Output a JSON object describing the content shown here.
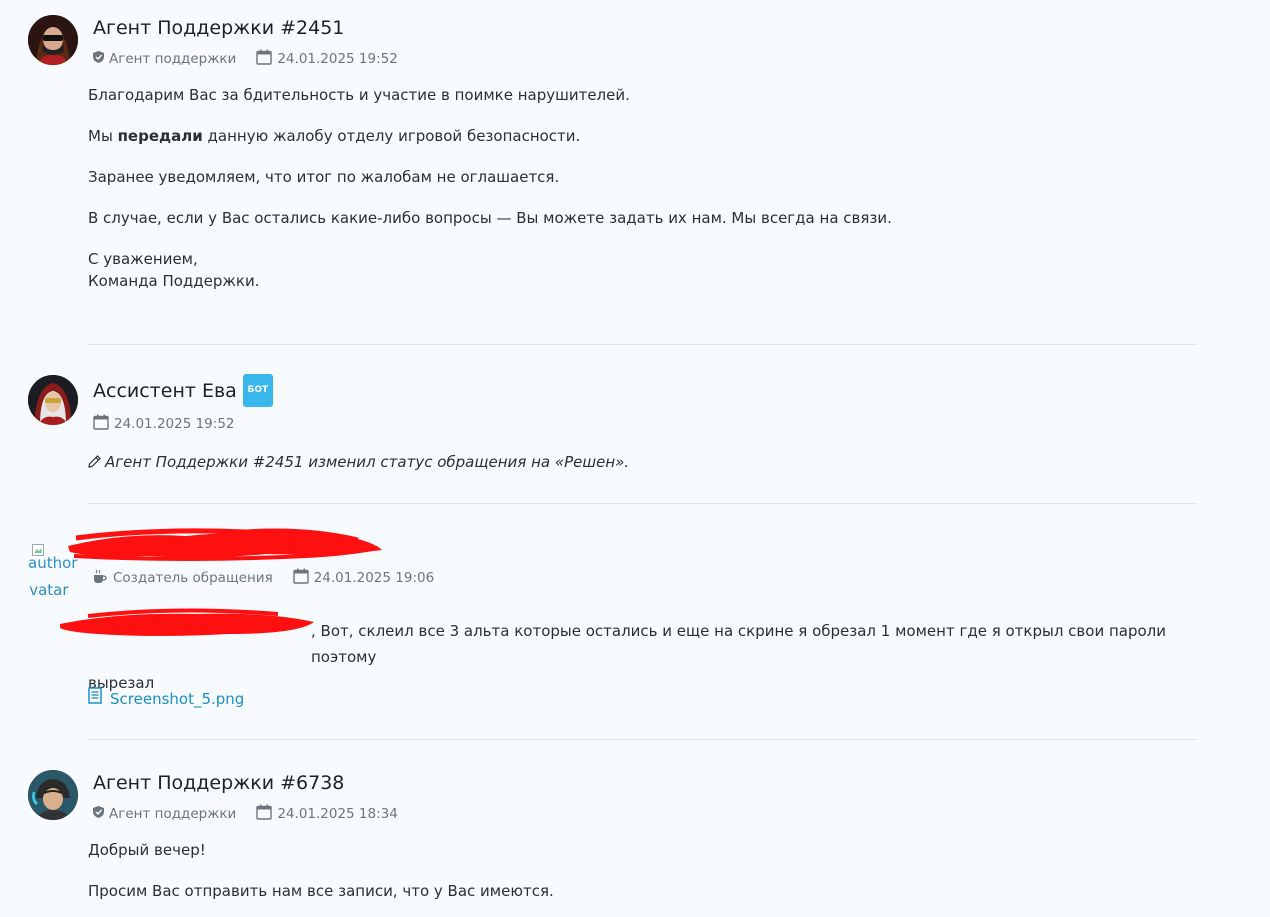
{
  "messages": [
    {
      "author": "Агент Поддержки #2451",
      "role": "Агент поддержки",
      "datetime": "24.01.2025 19:52",
      "paragraphs": {
        "p1": "Благодарим Вас за бдительность и участие в поимке нарушителей.",
        "p2_before": "Мы ",
        "p2_bold": "передали",
        "p2_after": " данную жалобу отделу игровой безопасности.",
        "p3": "Заранее уведомляем, что итог по жалобам не оглашается.",
        "p4": "В случае, если у Вас остались какие-либо вопросы — Вы можете задать их нам. Мы всегда на связи.",
        "p5_line1": "С уважением,",
        "p5_line2": "Команда Поддержки."
      }
    },
    {
      "author": "Ассистент Ева",
      "badge": "БОТ",
      "datetime": "24.01.2025 19:52",
      "status_text": "Агент Поддержки #2451 изменил статус обращения на «Решен»."
    },
    {
      "avatar_alt": "author avatar",
      "avatar_alt_line1": "author",
      "avatar_alt_line2": "avatar",
      "role": "Создатель обращения",
      "datetime": "24.01.2025 19:06",
      "text_line1": ", Вот, склеил все 3 альта которые  остались и еще на скрине я обрезал 1 момент где я открыл свои пароли поэтому",
      "text_line2": "вырезал",
      "attachment": "Screenshot_5.png"
    },
    {
      "author": "Агент Поддержки #6738",
      "role": "Агент поддержки",
      "datetime": "24.01.2025 18:34",
      "p1": "Добрый вечер!",
      "p2": "Просим Вас отправить нам все записи, что у Вас имеются."
    }
  ],
  "icons": {
    "shield": "shield-icon",
    "calendar": "calendar-icon",
    "pencil": "pencil-icon",
    "coffee": "coffee-icon",
    "document": "document-icon"
  },
  "colors": {
    "background": "#f8fbfd",
    "link": "#1a8fc9",
    "badge": "#3ab7ea",
    "redaction": "#ff0000",
    "meta": "#6c757d"
  }
}
